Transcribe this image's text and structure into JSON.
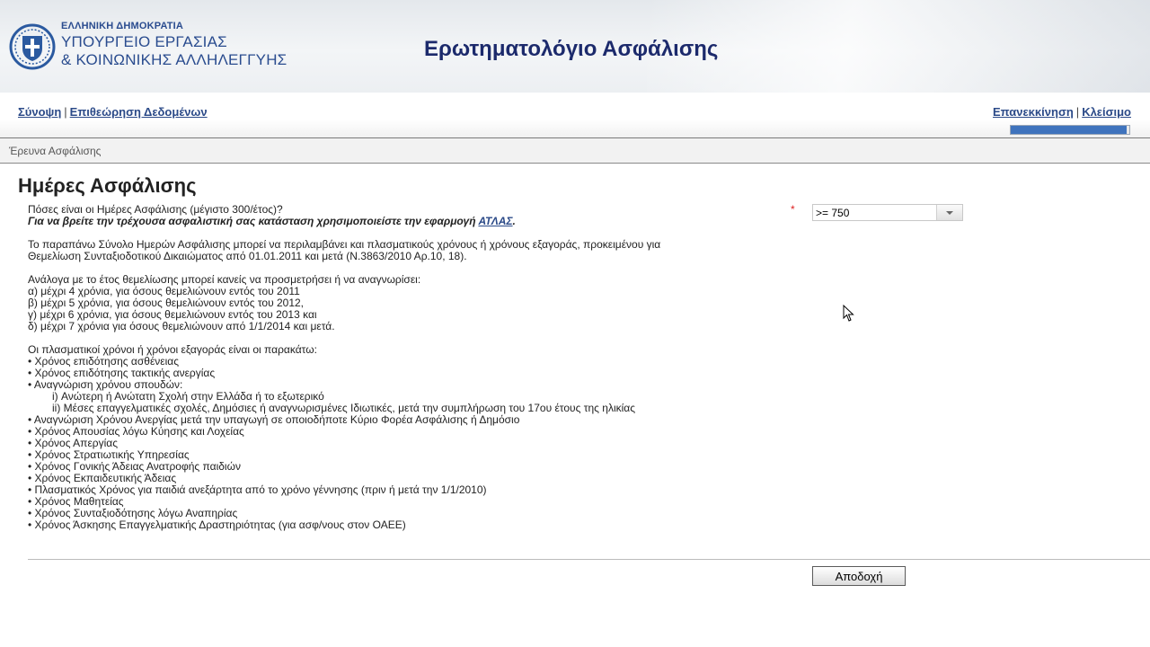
{
  "header": {
    "org_line1": "ΕΛΛΗΝΙΚΗ ΔΗΜΟΚΡΑΤΙΑ",
    "org_line2": "ΥΠΟΥΡΓΕΙΟ ΕΡΓΑΣΙΑΣ",
    "org_line3": "& ΚΟΙΝΩΝΙΚΗΣ ΑΛΛΗΛΕΓΓΥΗΣ",
    "title": "Ερωτηματολόγιο Ασφάλισης",
    "logo_icon": "greek-emblem-icon"
  },
  "nav": {
    "summary": "Σύνοψη",
    "review": "Επιθεώρηση Δεδομένων",
    "restart": "Επανεκκίνηση",
    "close": "Κλείσιμο",
    "separator": "|"
  },
  "progress": {
    "fraction": 0.98,
    "color": "#3f73bd"
  },
  "breadcrumb": "Έρευνα Ασφάλισης",
  "section": {
    "title": "Ημέρες Ασφάλισης",
    "question": "Πόσες είναι οι Ημέρες Ασφάλισης (μέγιστο 300/έτος)?",
    "hint_prefix": "Για να βρείτε την τρέχουσα ασφαλιστική σας κατάσταση χρησιμοποιείστε την εφαρμογή",
    "hint_link": "ΑΤΛΑΣ",
    "hint_suffix": ".",
    "para1_line1": "Το παραπάνω Σύνολο Ημερών Ασφάλισης μπορεί να περιλαμβάνει και πλασματικούς χρόνους ή χρόνους εξαγοράς, προκειμένου για",
    "para1_line2": "Θεμελίωση Συνταξιοδοτικού Δικαιώματος από 01.01.2011 και μετά (Ν.3863/2010 Αρ.10, 18).",
    "para2_intro": "Ανάλογα με το έτος θεμελίωσης μπορεί κανείς να προσμετρήσει ή να αναγνωρίσει:",
    "para2_items": [
      "α) μέχρι 4 χρόνια, για όσους θεμελιώνουν εντός του 2011",
      "β) μέχρι 5 χρόνια, για όσους θεμελιώνουν εντός του 2012,",
      "γ) μέχρι 6 χρόνια, για όσους θεμελιώνουν εντός του 2013 και",
      "δ) μέχρι 7 χρόνια για όσους θεμελιώνουν από 1/1/2014 και μετά."
    ],
    "para3_intro": "Οι πλασματικοί χρόνοι ή χρόνοι εξαγοράς είναι οι παρακάτω:",
    "para3_items_a": [
      "• Χρόνος επιδότησης ασθένειας",
      "• Χρόνος επιδότησης τακτικής ανεργίας",
      "• Αναγνώριση χρόνου σπουδών:"
    ],
    "para3_sub": [
      "i) Ανώτερη ή Ανώτατη Σχολή στην Ελλάδα ή το εξωτερικό",
      "ii) Μέσες επαγγελματικές σχολές, Δημόσιες ή αναγνωρισμένες Ιδιωτικές, μετά την συμπλήρωση του 17ου έτους της ηλικίας"
    ],
    "para3_items_b": [
      "• Αναγνώριση Χρόνου Ανεργίας μετά την υπαγωγή σε οποιοδήποτε Κύριο Φορέα Ασφάλισης ή Δημόσιο",
      "• Χρόνος Απουσίας λόγω Κύησης και Λοχείας",
      "• Χρόνος Απεργίας",
      "• Χρόνος Στρατιωτικής Υπηρεσίας",
      "• Χρόνος Γονικής Άδειας Ανατροφής παιδιών",
      "• Χρόνος Εκπαιδευτικής Άδειας",
      "• Πλασματικός Χρόνος για παιδιά ανεξάρτητα από το χρόνο γέννησης (πριν ή μετά την 1/1/2010)",
      "• Χρόνος Μαθητείας",
      "• Χρόνος Συνταξιοδότησης λόγω Αναπηρίας",
      "• Χρόνος Άσκησης Επαγγελματικής Δραστηριότητας (για ασφ/νους στον ΟΑΕΕ)"
    ]
  },
  "form": {
    "required_mark": "*",
    "selected_value": ">= 750",
    "dropdown_icon": "chevron-down-icon"
  },
  "buttons": {
    "accept": "Αποδοχή"
  }
}
